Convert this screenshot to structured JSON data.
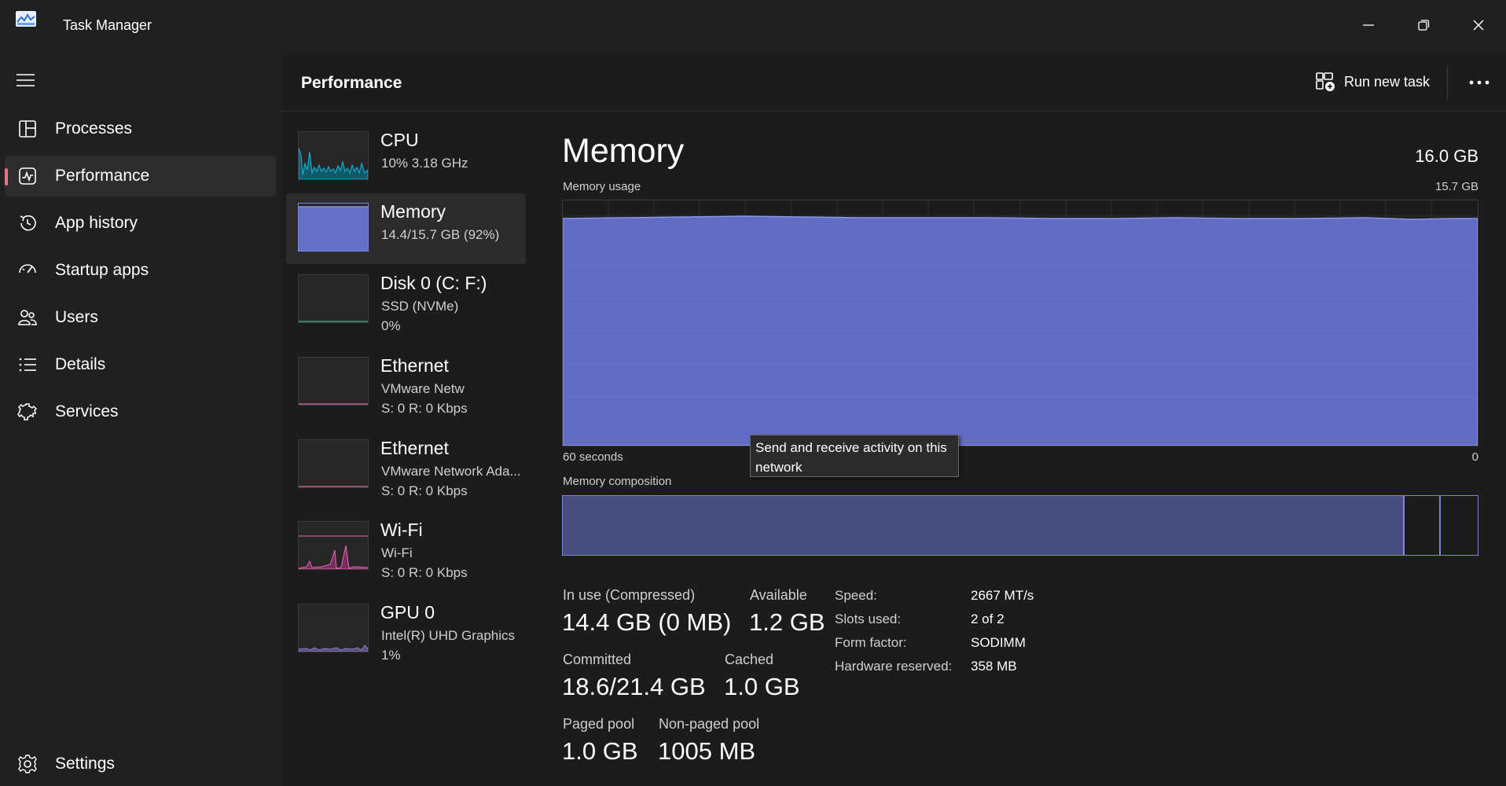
{
  "app": {
    "title": "Task Manager"
  },
  "sidebar": {
    "items": [
      {
        "label": "Processes",
        "icon": "processes-icon"
      },
      {
        "label": "Performance",
        "icon": "performance-icon",
        "active": true
      },
      {
        "label": "App history",
        "icon": "history-icon"
      },
      {
        "label": "Startup apps",
        "icon": "startup-icon"
      },
      {
        "label": "Users",
        "icon": "users-icon"
      },
      {
        "label": "Details",
        "icon": "details-icon"
      },
      {
        "label": "Services",
        "icon": "services-icon"
      }
    ],
    "settings_label": "Settings"
  },
  "header": {
    "title": "Performance",
    "run_new_task": "Run new task"
  },
  "devices": [
    {
      "name": "CPU",
      "sub1": "10%  3.18 GHz",
      "sub2": ""
    },
    {
      "name": "Memory",
      "sub1": "14.4/15.7 GB (92%)",
      "sub2": ""
    },
    {
      "name": "Disk 0 (C: F:)",
      "sub1": "SSD (NVMe)",
      "sub2": "0%"
    },
    {
      "name": "Ethernet",
      "sub1": "VMware Netw",
      "sub2": "S: 0  R: 0 Kbps"
    },
    {
      "name": "Ethernet",
      "sub1": "VMware Network Ada...",
      "sub2": "S: 0  R: 0 Kbps"
    },
    {
      "name": "Wi-Fi",
      "sub1": "Wi-Fi",
      "sub2": "S: 0  R: 0 Kbps"
    },
    {
      "name": "GPU 0",
      "sub1": "Intel(R) UHD Graphics",
      "sub2": "1%"
    }
  ],
  "tooltip": "Send and receive activity on this network",
  "detail": {
    "title": "Memory",
    "total": "16.0 GB",
    "usage_label": "Memory usage",
    "usage_max": "15.7 GB",
    "time_left": "60 seconds",
    "time_right": "0",
    "composition_label": "Memory composition",
    "composition": {
      "in_use_fraction": 0.92,
      "modified_fraction": 0.04
    },
    "stats": {
      "in_use_label": "In use (Compressed)",
      "in_use_value": "14.4 GB (0 MB)",
      "available_label": "Available",
      "available_value": "1.2 GB",
      "committed_label": "Committed",
      "committed_value": "18.6/21.4 GB",
      "cached_label": "Cached",
      "cached_value": "1.0 GB",
      "paged_label": "Paged pool",
      "paged_value": "1.0 GB",
      "nonpaged_label": "Non-paged pool",
      "nonpaged_value": "1005 MB"
    },
    "specs": {
      "speed_label": "Speed:",
      "speed_value": "2667 MT/s",
      "slots_label": "Slots used:",
      "slots_value": "2 of 2",
      "form_label": "Form factor:",
      "form_value": "SODIMM",
      "hw_label": "Hardware reserved:",
      "hw_value": "358 MB"
    }
  },
  "colors": {
    "memory_fill": "#6470c8",
    "memory_line": "#8c97ea",
    "cpu": "#17a9c6",
    "wifi": "#e468b4",
    "ethernet": "#d46fa8",
    "disk": "#4caf8a",
    "accent": "#ff6b81"
  }
}
